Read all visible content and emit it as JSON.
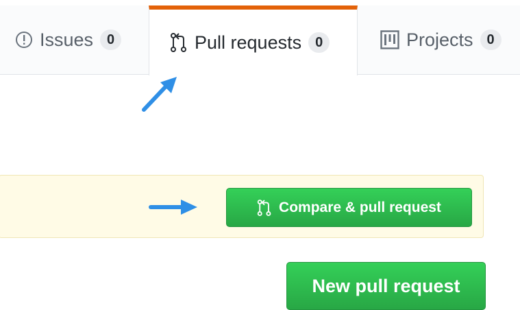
{
  "tabs": {
    "issues": {
      "label": "Issues",
      "count": "0",
      "icon": "issue-icon"
    },
    "pull_requests": {
      "label": "Pull requests",
      "count": "0",
      "icon": "git-pull-request-icon",
      "selected": true
    },
    "projects": {
      "label": "Projects",
      "count": "0",
      "icon": "project-icon"
    }
  },
  "banner": {
    "compare_button_label": "Compare & pull request",
    "compare_button_icon": "git-pull-request-icon"
  },
  "new_pr_button_label": "New pull request",
  "colors": {
    "accent_tab": "#e36209",
    "button_green": "#2cbe4e",
    "annotation_arrow": "#2f8fe6",
    "banner_bg": "#fffbe6"
  }
}
